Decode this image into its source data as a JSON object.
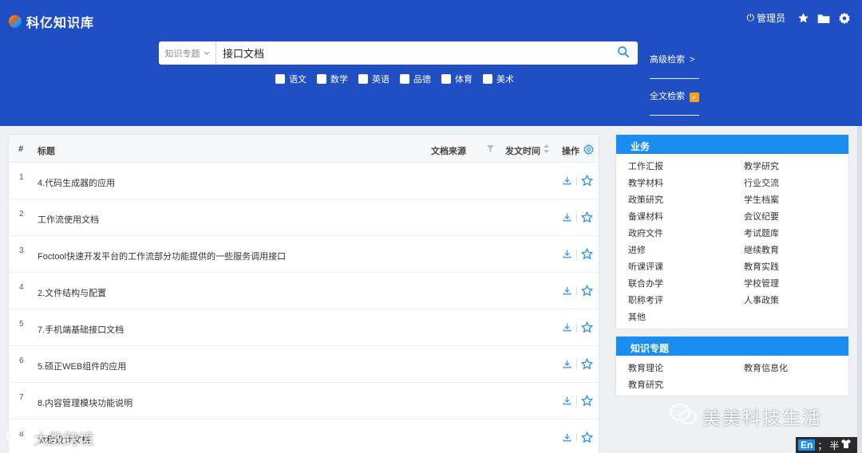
{
  "app": {
    "title": "科亿知识库"
  },
  "top_right": {
    "admin_label": "管理员"
  },
  "search": {
    "scope_label": "知识专题",
    "query": "接口文档",
    "advanced_label": "高级检索",
    "advanced_arrow": ">",
    "fulltext_label": "全文检索"
  },
  "subjects": [
    {
      "label": "语文"
    },
    {
      "label": "数学"
    },
    {
      "label": "英语"
    },
    {
      "label": "品德"
    },
    {
      "label": "体育"
    },
    {
      "label": "美术"
    }
  ],
  "table": {
    "headers": {
      "num": "#",
      "title": "标题",
      "source": "文档来源",
      "date": "发文时间",
      "ops": "操作"
    },
    "rows": [
      {
        "num": "1",
        "title": "4.代码生成器的应用"
      },
      {
        "num": "2",
        "title": "工作流使用文档"
      },
      {
        "num": "3",
        "title": "Foctool快速开发平台的工作流部分功能提供的一些服务调用接口"
      },
      {
        "num": "4",
        "title": "2.文件结构与配置"
      },
      {
        "num": "5",
        "title": "7.手机端基础接口文档"
      },
      {
        "num": "6",
        "title": "5.硕正WEB组件的应用"
      },
      {
        "num": "7",
        "title": "8.内容管理模块功能说明"
      },
      {
        "num": "8",
        "title": "流程设计文档"
      }
    ]
  },
  "panels": {
    "business": {
      "title": "业务",
      "items": [
        "工作汇报",
        "教学研究",
        "教学材料",
        "行业交流",
        "政策研究",
        "学生档案",
        "备课材料",
        "会议纪要",
        "政府文件",
        "考试题库",
        "进修",
        "继续教育",
        "听课评课",
        "教育实践",
        "联合办学",
        "学校管理",
        "职称考评",
        "人事政策",
        "其他"
      ]
    },
    "topics": {
      "title": "知识专题",
      "items": [
        "教育理论",
        "教育信息化",
        "教育研究"
      ]
    }
  },
  "watermarks": {
    "right": "美美科技生活",
    "left": "大数跨境"
  },
  "ime": {
    "lang": "En",
    "punct": "；",
    "width": "半"
  },
  "colors": {
    "header": "#1f4fc3",
    "panel_head": "#1a8ef0",
    "accent_icon": "#1a8ef0",
    "check_orange": "#f7a21b"
  }
}
